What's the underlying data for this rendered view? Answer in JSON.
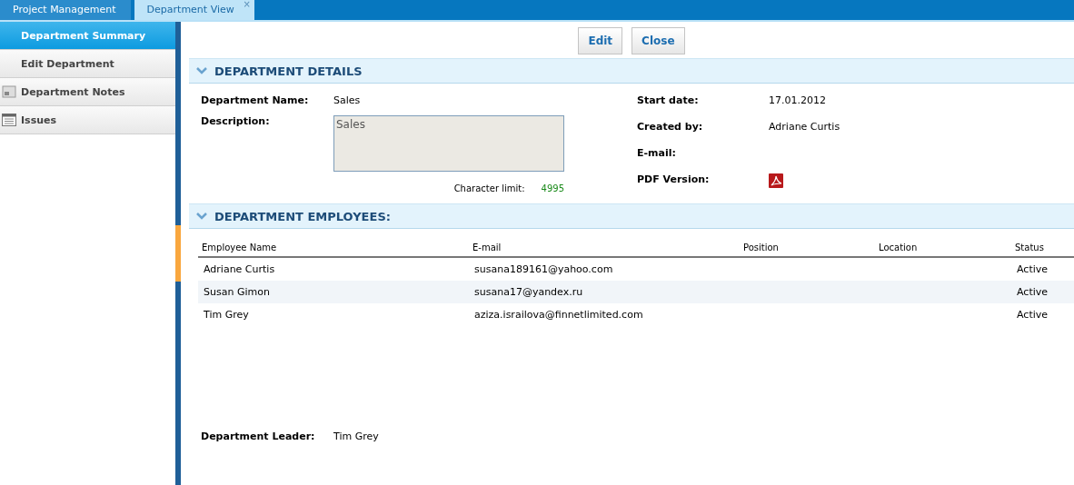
{
  "tabs": [
    {
      "label": "Project Management",
      "selected": false
    },
    {
      "label": "Department View",
      "selected": true,
      "close_glyph": "×"
    }
  ],
  "sidebar": {
    "items": [
      {
        "label": "Department Summary",
        "selected": true,
        "kind": "plain"
      },
      {
        "label": "Edit Department",
        "selected": false,
        "kind": "plain"
      },
      {
        "label": "Department Notes",
        "selected": false,
        "kind": "note"
      },
      {
        "label": "Issues",
        "selected": false,
        "kind": "list"
      }
    ]
  },
  "toolbar": {
    "buttons": [
      "Edit",
      "Close"
    ]
  },
  "details": {
    "title": "DEPARTMENT DETAILS",
    "expanded": true,
    "name_label": "Department Name:",
    "name": "Sales",
    "description_label": "Description:",
    "description": "Sales",
    "char_limit_label": "Character limit:",
    "char_limit": "4995",
    "right_fields": [
      {
        "label": "Start date:",
        "value": "17.01.2012",
        "kind": "text"
      },
      {
        "label": "Created by:",
        "value": "Adriane Curtis",
        "kind": "text"
      },
      {
        "label": "E-mail:",
        "kind": "text"
      },
      {
        "label": "PDF Version:",
        "kind": "pdf"
      }
    ]
  },
  "employees": {
    "title": "DEPARTMENT EMPLOYEES:",
    "expanded": true,
    "columns": [
      "Employee Name",
      "E-mail",
      "Position",
      "Location",
      "Status"
    ],
    "rows": [
      {
        "name": "Adriane Curtis",
        "email": "susana189161@yahoo.com",
        "status": "Active"
      },
      {
        "name": "Susan Gimon",
        "email": "susana17@yandex.ru",
        "status": "Active"
      },
      {
        "name": "Tim Grey",
        "email": "aziza.israilova@finnetlimited.com",
        "status": "Active"
      }
    ]
  },
  "leader": {
    "label": "Department Leader:",
    "value": "Tim Grey"
  }
}
